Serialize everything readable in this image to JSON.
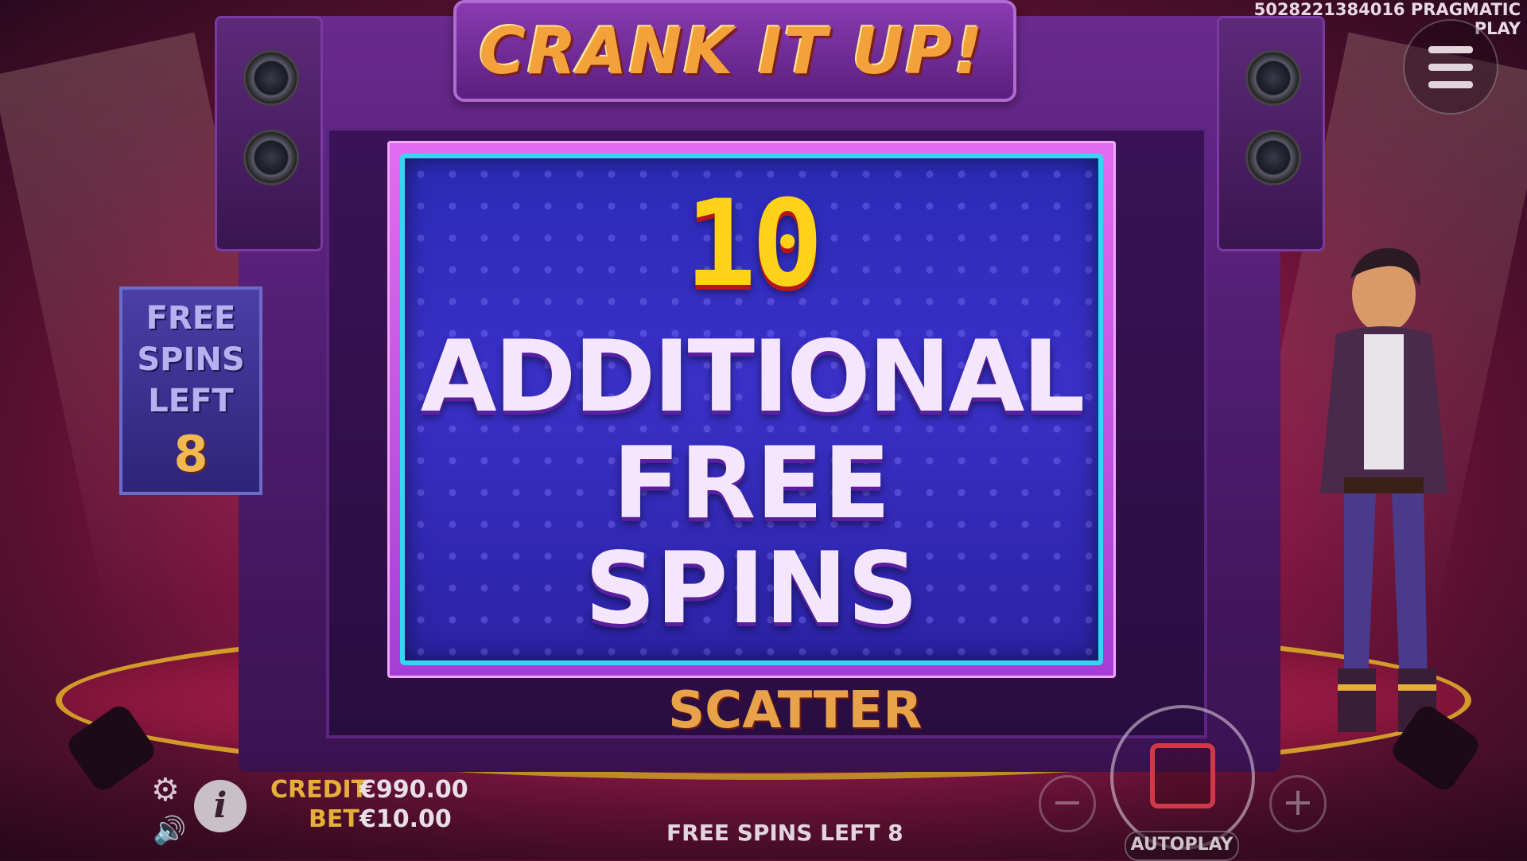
{
  "game": {
    "logo_text": "CRANK IT UP!",
    "round_id": "5028221384016",
    "provider": "PRAGMATIC PLAY"
  },
  "side_panel": {
    "label_line1": "FREE",
    "label_line2": "SPINS",
    "label_line3": "LEFT",
    "count": "8"
  },
  "popup": {
    "number": "10",
    "line1": "ADDITIONAL",
    "line2": "FREE",
    "line3": "SPINS"
  },
  "reels": {
    "visible_symbol_label": "SCATTER"
  },
  "footer": {
    "credit_label": "CREDIT",
    "credit_value": "€990.00",
    "bet_label": "BET",
    "bet_value": "€10.00",
    "status_text": "FREE SPINS LEFT 8",
    "autoplay_label": "AUTOPLAY",
    "minus_symbol": "−",
    "plus_symbol": "+"
  },
  "icons": {
    "settings": "gear-icon",
    "sound": "speaker-icon",
    "info": "info-icon",
    "menu": "hamburger-menu-icon"
  },
  "colors": {
    "accent_gold": "#ffd21a",
    "popup_blue": "#2a2bb6",
    "popup_border": "#36d6f0",
    "stop_red": "#d03a48"
  }
}
